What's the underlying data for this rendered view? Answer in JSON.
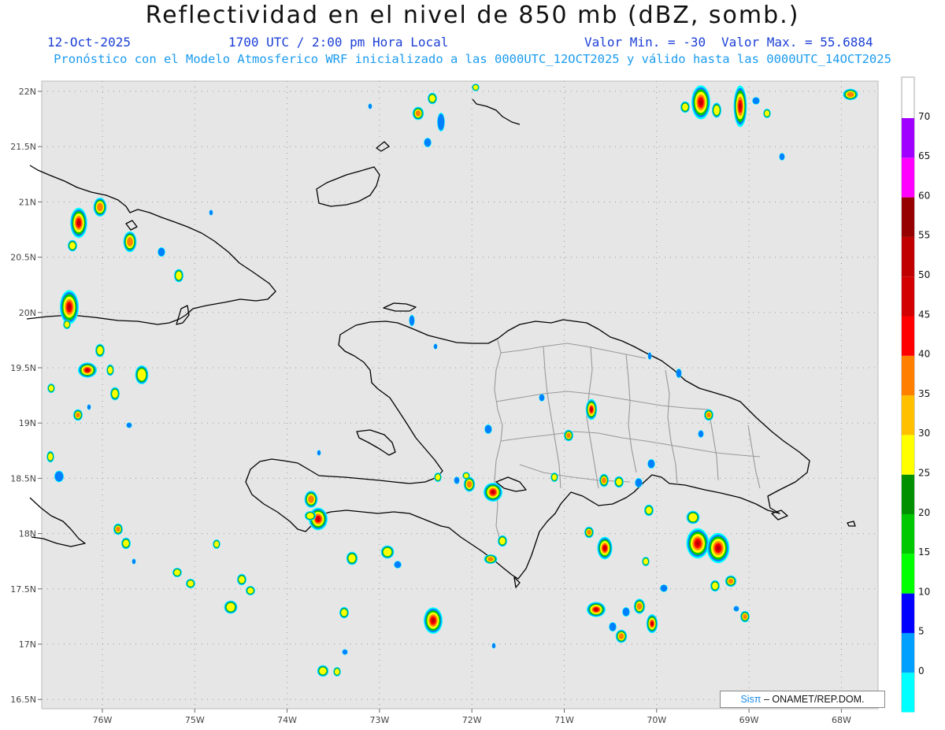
{
  "header": {
    "title": "Reflectividad en el nivel de 850 mb (dBZ, somb.)",
    "date": "12-Oct-2025",
    "time": "1700 UTC / 2:00 pm Hora Local",
    "min_label": "Valor Min. = -30",
    "max_label": "Valor Max. = 55.6884",
    "model_line": "Pronóstico con el Modelo Atmosferico WRF inicializado a las 0000UTC_12OCT2025 y válido hasta las 0000UTC_14OCT2025"
  },
  "axes": {
    "lat_labels": [
      "22N",
      "21.5N",
      "21N",
      "20.5N",
      "20N",
      "19.5N",
      "19N",
      "18.5N",
      "18N",
      "17.5N",
      "17N",
      "16.5N"
    ],
    "lon_labels": [
      "76W",
      "75W",
      "74W",
      "73W",
      "72W",
      "71W",
      "70W",
      "69W",
      "68W"
    ]
  },
  "colorbar": {
    "labels": [
      "0",
      "5",
      "10",
      "15",
      "20",
      "25",
      "30",
      "35",
      "40",
      "45",
      "50",
      "55",
      "60",
      "65",
      "70"
    ],
    "colors": [
      "#00ffff",
      "#00a0ff",
      "#0000ff",
      "#00ff00",
      "#00c800",
      "#009000",
      "#ffff00",
      "#ffc000",
      "#ff8000",
      "#ff0000",
      "#d20000",
      "#c00000",
      "#960000",
      "#ff00ff",
      "#a000ff"
    ],
    "below_color": "#e6e6e6"
  },
  "credit": {
    "sis": "Sisπ",
    "text": "– ONAMET/REP.DOM."
  }
}
